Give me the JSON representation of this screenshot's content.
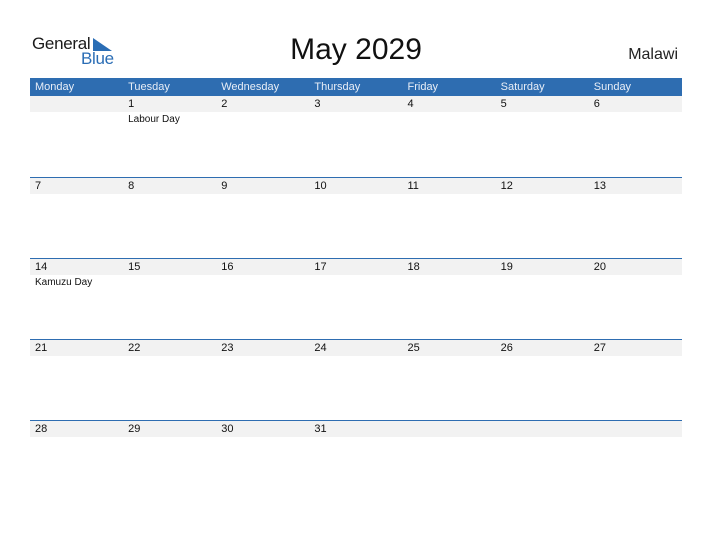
{
  "logo": {
    "text_general": "General",
    "text_blue": "Blue",
    "icon": "triangle-flag-icon"
  },
  "title": "May 2029",
  "country": "Malawi",
  "colors": {
    "header_bg": "#2e6db1",
    "day_row_bg": "#f2f2f2",
    "logo_blue": "#2a6db5"
  },
  "weekdays": [
    "Monday",
    "Tuesday",
    "Wednesday",
    "Thursday",
    "Friday",
    "Saturday",
    "Sunday"
  ],
  "weeks": [
    {
      "days": [
        "",
        "1",
        "2",
        "3",
        "4",
        "5",
        "6"
      ],
      "events": [
        "",
        "Labour Day",
        "",
        "",
        "",
        "",
        ""
      ]
    },
    {
      "days": [
        "7",
        "8",
        "9",
        "10",
        "11",
        "12",
        "13"
      ],
      "events": [
        "",
        "",
        "",
        "",
        "",
        "",
        ""
      ]
    },
    {
      "days": [
        "14",
        "15",
        "16",
        "17",
        "18",
        "19",
        "20"
      ],
      "events": [
        "Kamuzu Day",
        "",
        "",
        "",
        "",
        "",
        ""
      ]
    },
    {
      "days": [
        "21",
        "22",
        "23",
        "24",
        "25",
        "26",
        "27"
      ],
      "events": [
        "",
        "",
        "",
        "",
        "",
        "",
        ""
      ]
    },
    {
      "days": [
        "28",
        "29",
        "30",
        "31",
        "",
        "",
        ""
      ],
      "events": [
        "",
        "",
        "",
        "",
        "",
        "",
        ""
      ]
    }
  ]
}
